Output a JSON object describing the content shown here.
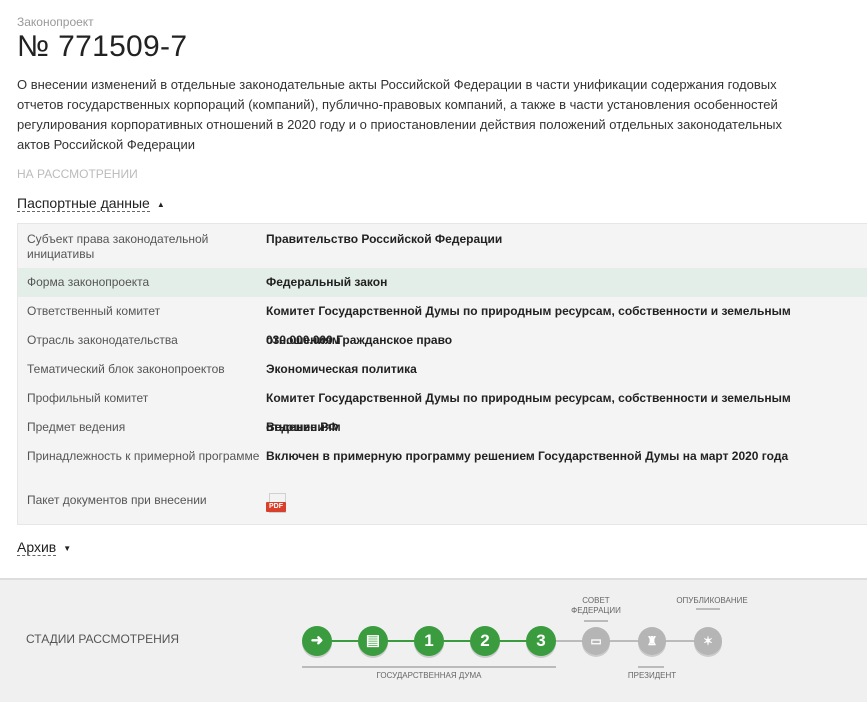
{
  "header": {
    "overline": "Законопроект",
    "bill_number": "№ 771509-7",
    "description": "О внесении изменений в отдельные законодательные акты Российской Федерации в части унификации содержания годовых отчетов государственных корпораций (компаний), публично-правовых компаний, а также в части установления особенностей регулирования корпоративных отношений в 2020 году и о приостановлении действия положений отдельных законодательных актов Российской Федерации",
    "status": "НА РАССМОТРЕНИИ"
  },
  "passport": {
    "toggle_label": "Паспортные данные",
    "rows": [
      {
        "key": "Субъект права законодательной инициативы",
        "value": "Правительство Российской Федерации"
      },
      {
        "key": "Форма законопроекта",
        "value": "Федеральный закон"
      },
      {
        "key": "Ответственный комитет",
        "value": "Комитет Государственной Думы по природным ресурсам, собственности и земельным отношениям"
      },
      {
        "key": "Отрасль законодательства",
        "value": "030.000.000 Гражданское право"
      },
      {
        "key": "Тематический блок законопроектов",
        "value": "Экономическая политика"
      },
      {
        "key": "Профильный комитет",
        "value": "Комитет Государственной Думы по природным ресурсам, собственности и земельным отношениям"
      },
      {
        "key": "Предмет ведения",
        "value": "Ведение РФ"
      },
      {
        "key": "Принадлежность к примерной программе",
        "value": "Включен в примерную программу решением Государственной Думы на март 2020 года"
      },
      {
        "key": "Пакет документов при внесении",
        "value": ""
      }
    ],
    "pdf_label": "PDF"
  },
  "archive": {
    "toggle_label": "Архив"
  },
  "stages": {
    "label": "СТАДИИ РАССМОТРЕНИЯ",
    "steps": [
      {
        "icon": "arrow-right-icon",
        "text": "➜",
        "state": "done"
      },
      {
        "icon": "document-list-icon",
        "text": "▤",
        "state": "done"
      },
      {
        "icon": "",
        "text": "1",
        "state": "done"
      },
      {
        "icon": "",
        "text": "2",
        "state": "done"
      },
      {
        "icon": "",
        "text": "3",
        "state": "done"
      },
      {
        "icon": "federation-council-icon",
        "text": "▭",
        "state": "pending"
      },
      {
        "icon": "president-icon",
        "text": "♜",
        "state": "pending"
      },
      {
        "icon": "published-emblem-icon",
        "text": "✶",
        "state": "pending"
      }
    ],
    "group_labels": {
      "duma": "ГОСУДАРСТВЕННАЯ ДУМА",
      "federation_council": "СОВЕТ ФЕДЕРАЦИИ",
      "president": "ПРЕЗИДЕНТ",
      "published": "ОПУБЛИКОВАНИЕ"
    },
    "colors": {
      "done": "#3a9c3f",
      "pending": "#b5b5b5"
    }
  }
}
